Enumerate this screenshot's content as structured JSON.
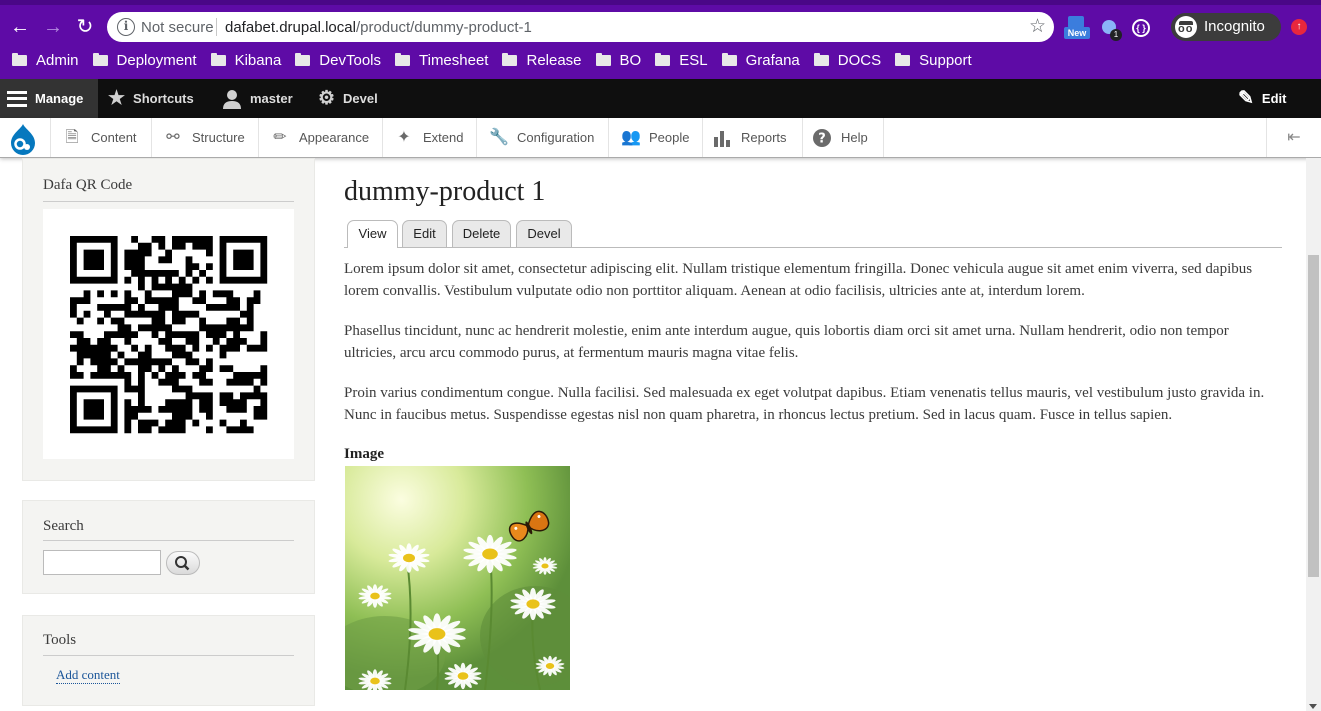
{
  "browser": {
    "security": "Not secure",
    "url_host": "dafabet.drupal.local",
    "url_path": "/product/dummy-product-1",
    "ext_new_label": "New",
    "ext_badge": "1",
    "incognito_label": "Incognito",
    "bookmarks": [
      "Admin",
      "Deployment",
      "Kibana",
      "DevTools",
      "Timesheet",
      "Release",
      "BO",
      "ESL",
      "Grafana",
      "DOCS",
      "Support"
    ]
  },
  "toolbar": {
    "manage": "Manage",
    "shortcuts": "Shortcuts",
    "user": "master",
    "devel": "Devel",
    "edit": "Edit"
  },
  "tray": {
    "items": [
      "Content",
      "Structure",
      "Appearance",
      "Extend",
      "Configuration",
      "People",
      "Reports",
      "Help"
    ]
  },
  "sidebar": {
    "qr_title": "Dafa QR Code",
    "search_title": "Search",
    "tools_title": "Tools",
    "add_content": "Add content"
  },
  "main": {
    "title": "dummy-product 1",
    "tabs": [
      "View",
      "Edit",
      "Delete",
      "Devel"
    ],
    "paragraphs": [
      "Lorem ipsum dolor sit amet, consectetur adipiscing elit. Nullam tristique elementum fringilla. Donec vehicula augue sit amet enim viverra, sed dapibus lorem convallis. Vestibulum vulputate odio non porttitor aliquam. Aenean at odio facilisis, ultricies ante at, interdum lorem.",
      "Phasellus tincidunt, nunc ac hendrerit molestie, enim ante interdum augue, quis lobortis diam orci sit amet urna. Nullam hendrerit, odio non tempor ultricies, arcu arcu commodo purus, at fermentum mauris magna vitae felis.",
      "Proin varius condimentum congue. Nulla facilisi. Sed malesuada ex eget volutpat dapibus. Etiam venenatis tellus mauris, vel vestibulum justo gravida in. Nunc in faucibus metus. Suspendisse egestas nisl non quam pharetra, in rhoncus lectus pretium. Sed in lacus quam. Fusce in tellus sapien."
    ],
    "image_label": "Image"
  },
  "colors": {
    "chrome": "#5e0ba6",
    "toolbar": "#0f0f0f",
    "link": "#1a5599"
  }
}
